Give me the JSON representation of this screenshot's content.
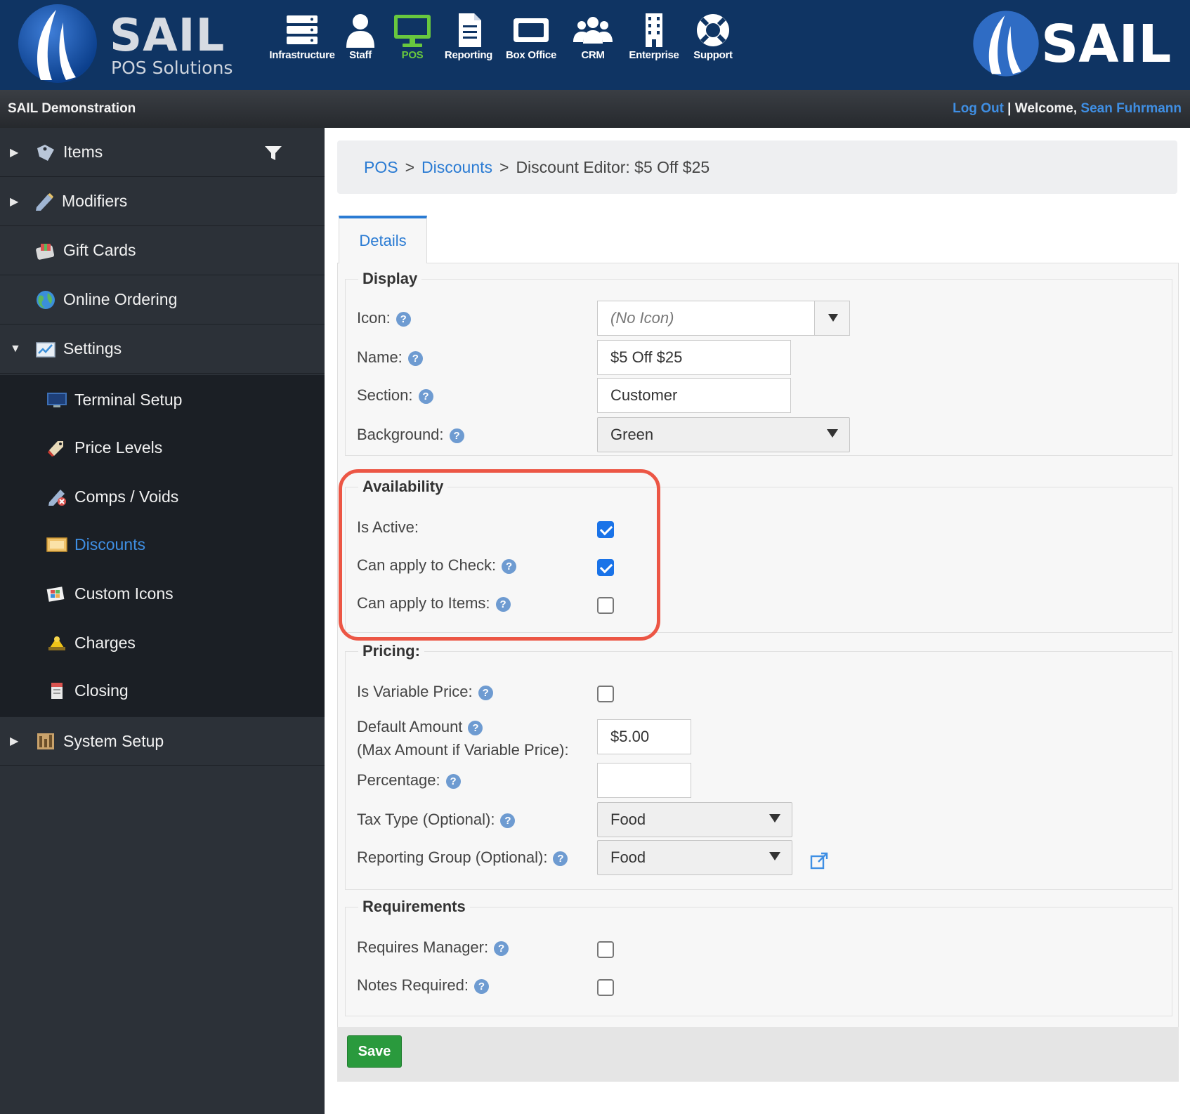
{
  "header": {
    "brand": "SAIL",
    "brand_sub": "POS Solutions",
    "right_brand": "SAIL",
    "nav": [
      {
        "label": "Infrastructure",
        "icon": "server-icon"
      },
      {
        "label": "Staff",
        "icon": "person-icon"
      },
      {
        "label": "POS",
        "icon": "monitor-icon",
        "active": true
      },
      {
        "label": "Reporting",
        "icon": "document-icon"
      },
      {
        "label": "Box Office",
        "icon": "ticket-box-icon"
      },
      {
        "label": "CRM",
        "icon": "people-icon"
      },
      {
        "label": "Enterprise",
        "icon": "building-icon"
      },
      {
        "label": "Support",
        "icon": "lifebuoy-icon"
      }
    ]
  },
  "subheader": {
    "org": "SAIL Demonstration",
    "logout": "Log Out",
    "separator": " | ",
    "welcome": "Welcome, ",
    "user": "Sean Fuhrmann"
  },
  "sidebar": {
    "items": [
      {
        "label": "Items",
        "icon": "tag-items-icon"
      },
      {
        "label": "Modifiers",
        "icon": "pencil-tag-icon"
      },
      {
        "label": "Gift Cards",
        "icon": "gift-card-icon"
      },
      {
        "label": "Online Ordering",
        "icon": "globe-icon"
      },
      {
        "label": "Settings",
        "icon": "settings-chart-icon"
      },
      {
        "label": "System Setup",
        "icon": "system-setup-icon"
      }
    ],
    "settings_children": [
      {
        "label": "Terminal Setup",
        "icon": "terminal-icon"
      },
      {
        "label": "Price Levels",
        "icon": "price-tag-icon"
      },
      {
        "label": "Comps / Voids",
        "icon": "comps-voids-icon"
      },
      {
        "label": "Discounts",
        "icon": "discount-icon",
        "current": true
      },
      {
        "label": "Custom Icons",
        "icon": "custom-icons-icon"
      },
      {
        "label": "Charges",
        "icon": "charges-icon"
      },
      {
        "label": "Closing",
        "icon": "closing-icon"
      }
    ]
  },
  "breadcrumb": {
    "pos": "POS",
    "sep": ">",
    "discounts": "Discounts",
    "current": "Discount Editor: $5 Off $25"
  },
  "tab": {
    "label": "Details"
  },
  "display": {
    "legend": "Display",
    "icon_label": "Icon:",
    "icon_value": "(No Icon)",
    "name_label": "Name:",
    "name_value": "$5 Off $25",
    "section_label": "Section:",
    "section_value": "Customer",
    "background_label": "Background:",
    "background_value": "Green"
  },
  "availability": {
    "legend": "Availability",
    "is_active_label": "Is Active:",
    "is_active": true,
    "apply_check_label": "Can apply to Check:",
    "apply_check": true,
    "apply_items_label": "Can apply to Items:",
    "apply_items": false
  },
  "pricing": {
    "legend": "Pricing:",
    "variable_label": "Is Variable Price:",
    "variable": false,
    "default_amount_label": "Default Amount",
    "default_amount_sub": "(Max Amount if Variable Price):",
    "default_amount_value": "$5.00",
    "percentage_label": "Percentage:",
    "percentage_value": "",
    "tax_label": "Tax Type (Optional):",
    "tax_value": "Food",
    "reporting_label": "Reporting Group (Optional):",
    "reporting_value": "Food"
  },
  "requirements": {
    "legend": "Requirements",
    "manager_label": "Requires Manager:",
    "manager": false,
    "notes_label": "Notes Required:",
    "notes": false
  },
  "actions": {
    "save": "Save"
  },
  "help_glyph": "?",
  "colors": {
    "header_bg": "#0f3463",
    "accent_blue": "#2a7bd3",
    "active_nav_green": "#68c83e",
    "save_green": "#2a9a3d",
    "highlight_red": "#ec5645",
    "sidebar_bg": "#2c3138"
  }
}
